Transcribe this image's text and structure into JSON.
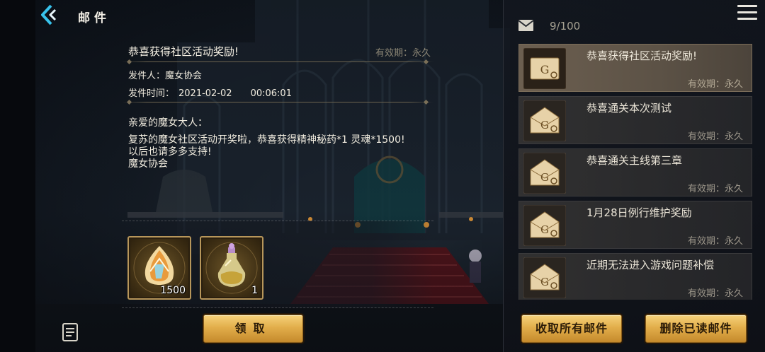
{
  "header": {
    "title": "邮件"
  },
  "detail": {
    "title": "恭喜获得社区活动奖励!",
    "validity": "有效期：永久",
    "sender_label": "发件人：",
    "sender": "魔女协会",
    "time_label": "发件时间：",
    "date": "2021-02-02",
    "time": "00:06:01",
    "greeting": "亲爱的魔女大人：",
    "lines": [
      "复苏的魔女社区活动开奖啦，恭喜获得精神秘药*1 灵魂*1500!",
      "以后也请多多支持!",
      "魔女协会"
    ],
    "rewards": [
      {
        "icon": "soul-crystal-icon",
        "count": "1500"
      },
      {
        "icon": "potion-bottle-icon",
        "count": "1"
      }
    ],
    "claim_label": "领取"
  },
  "mailbox": {
    "count": "9/100",
    "items": [
      {
        "subject": "恭喜获得社区活动奖励!",
        "validity": "有效期：永久",
        "active": true
      },
      {
        "subject": "恭喜通关本次测试",
        "validity": "有效期：永久",
        "active": false
      },
      {
        "subject": "恭喜通关主线第三章",
        "validity": "有效期：永久",
        "active": false
      },
      {
        "subject": "1月28日例行维护奖励",
        "validity": "有效期：永久",
        "active": false
      },
      {
        "subject": "近期无法进入游戏问题补偿",
        "validity": "有效期：永久",
        "active": false
      }
    ],
    "collect_all_label": "收取所有邮件",
    "delete_read_label": "删除已读邮件"
  },
  "colors": {
    "gold_button": "#e2ae4b",
    "active_mail": "#6c5f50",
    "back_arrow": "#38c3ec"
  }
}
